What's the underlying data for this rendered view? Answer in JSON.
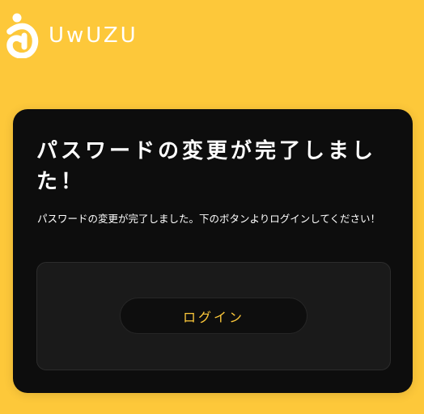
{
  "header": {
    "logo_text": "UwUZU",
    "logo_icon": "uwuzu-logo-icon"
  },
  "card": {
    "title": "パスワードの変更が完了しました！",
    "description": "パスワードの変更が完了しました。下のボタンよりログインしてください！",
    "login_button_label": "ログイン"
  },
  "colors": {
    "background": "#fdc83a",
    "card": "#0d0d0d",
    "inner_box": "#1a1a1a",
    "button_text": "#fdc83a"
  }
}
